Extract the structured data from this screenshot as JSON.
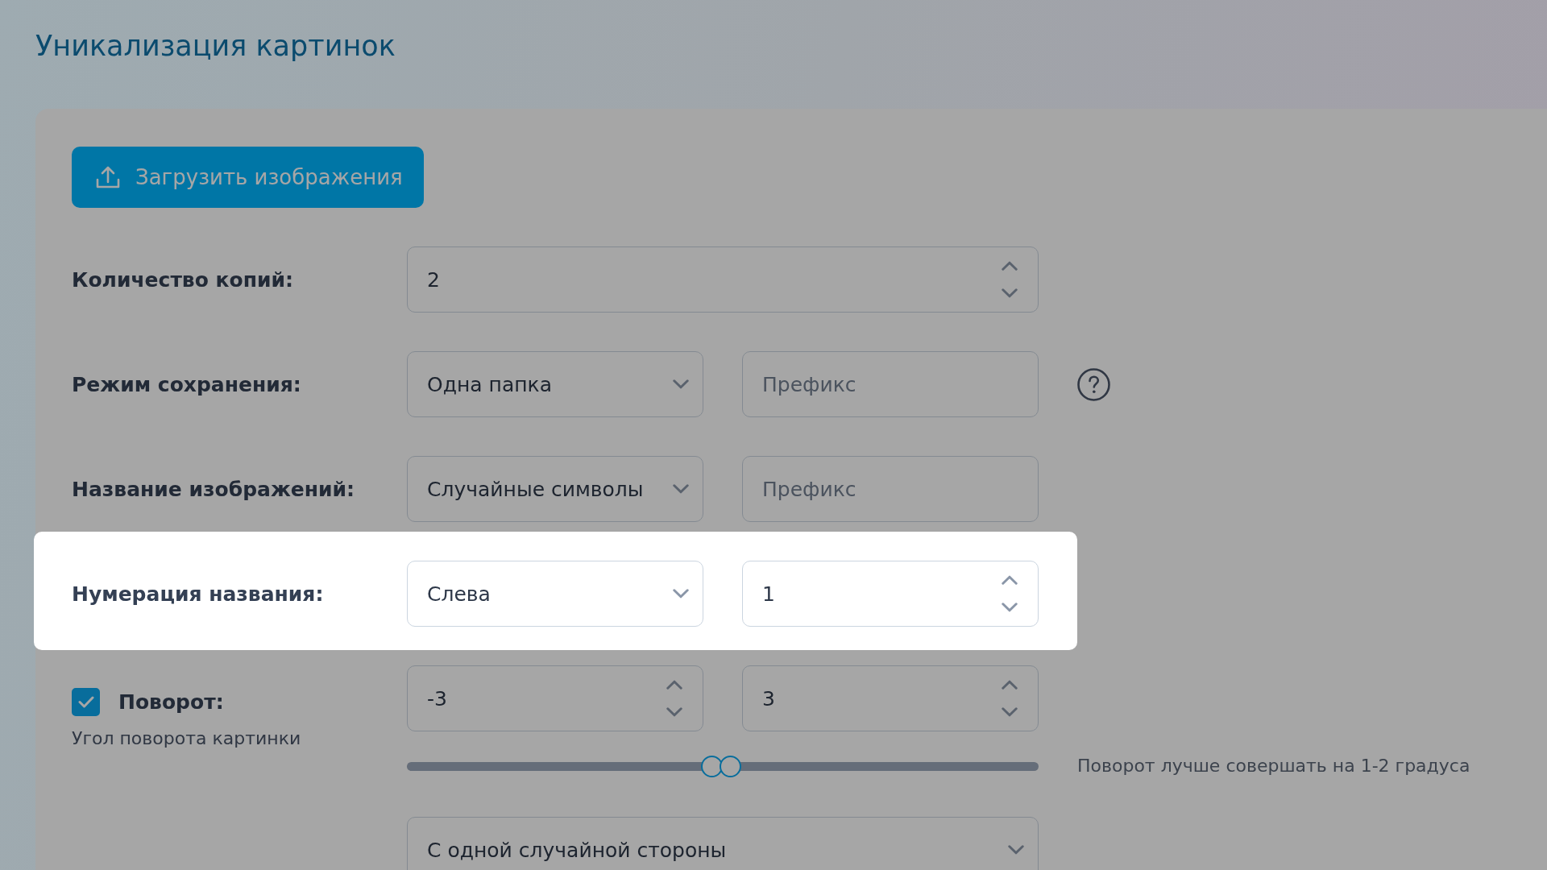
{
  "page": {
    "title": "Уникализация картинок"
  },
  "upload_button": {
    "label": "Загрузить изображения"
  },
  "rows": [
    {
      "label": "Количество копий:",
      "highlighted": false,
      "help": false,
      "fields": [
        {
          "kind": "number",
          "value": "2"
        }
      ]
    },
    {
      "label": "Режим сохранения:",
      "highlighted": false,
      "help": true,
      "fields": [
        {
          "kind": "select",
          "value": "Одна папка"
        },
        {
          "kind": "text",
          "placeholder": "Префикс"
        }
      ]
    },
    {
      "label": "Название изображений:",
      "highlighted": false,
      "help": false,
      "fields": [
        {
          "kind": "select",
          "value": "Случайные символы"
        },
        {
          "kind": "text",
          "placeholder": "Префикс"
        }
      ]
    },
    {
      "label": "Нумерация названия:",
      "highlighted": true,
      "help": false,
      "fields": [
        {
          "kind": "select",
          "value": "Слева"
        },
        {
          "kind": "number",
          "value": "1"
        }
      ]
    }
  ],
  "rotation": {
    "label": "Поворот:",
    "checked": true,
    "highlighted": false,
    "caption": "Угол поворота картинки",
    "fields": [
      {
        "kind": "number",
        "value": "-3"
      },
      {
        "kind": "number",
        "value": "3"
      }
    ],
    "slider": {
      "thumbs": [
        {
          "level": 0.483
        },
        {
          "level": 0.512
        }
      ]
    },
    "hint": "Поворот лучше совершать на 1-2 градуса",
    "mode": {
      "kind": "select",
      "value": "С одной случайной стороны"
    }
  }
}
